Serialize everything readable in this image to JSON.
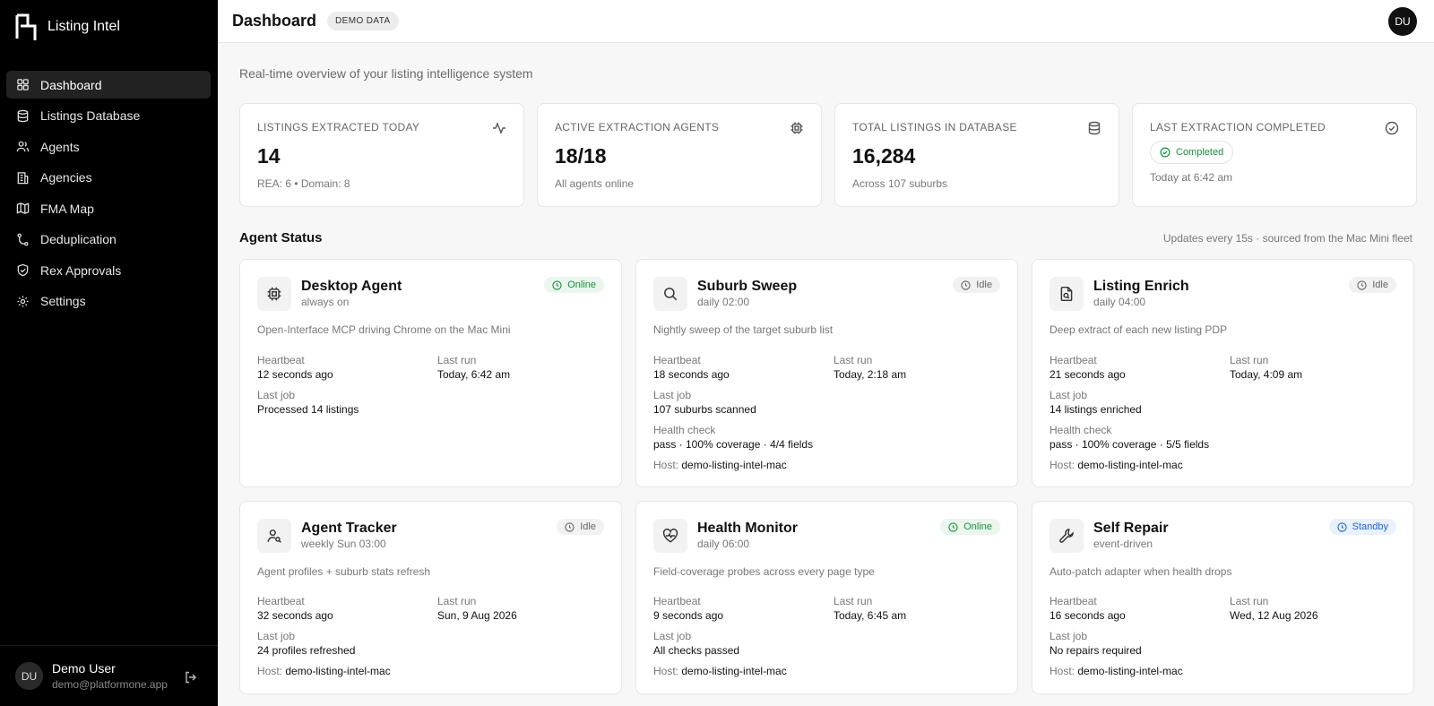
{
  "app": {
    "name": "Listing Intel"
  },
  "nav": [
    {
      "label": "Dashboard",
      "icon": "grid-icon",
      "active": true
    },
    {
      "label": "Listings Database",
      "icon": "database-icon"
    },
    {
      "label": "Agents",
      "icon": "users-icon"
    },
    {
      "label": "Agencies",
      "icon": "building-icon"
    },
    {
      "label": "FMA Map",
      "icon": "map-icon"
    },
    {
      "label": "Deduplication",
      "icon": "git-merge-icon"
    },
    {
      "label": "Rex Approvals",
      "icon": "shield-check-icon"
    },
    {
      "label": "Settings",
      "icon": "gear-icon"
    }
  ],
  "user": {
    "initials": "DU",
    "name": "Demo User",
    "email": "demo@platformone.app"
  },
  "header": {
    "title": "Dashboard",
    "badge": "DEMO DATA",
    "avatar": "DU"
  },
  "subtitle": "Real-time overview of your listing intelligence system",
  "stats": [
    {
      "label": "LISTINGS EXTRACTED TODAY",
      "value": "14",
      "sub": "REA: 6 • Domain: 8",
      "icon": "activity-icon"
    },
    {
      "label": "ACTIVE EXTRACTION AGENTS",
      "value": "18/18",
      "sub": "All agents online",
      "icon": "cpu-icon"
    },
    {
      "label": "TOTAL LISTINGS IN DATABASE",
      "value": "16,284",
      "sub": "Across 107 suburbs",
      "icon": "database-icon"
    },
    {
      "label": "LAST EXTRACTION COMPLETED",
      "pill": "Completed",
      "sub": "Today at 6:42 am",
      "icon": "check-circle-icon"
    }
  ],
  "agent_section": {
    "title": "Agent Status",
    "note": "Updates every 15s · sourced from the Mac Mini fleet"
  },
  "field_labels": {
    "heartbeat": "Heartbeat",
    "last_run": "Last run",
    "last_job": "Last job",
    "health": "Health check",
    "host": "Host:"
  },
  "agents": [
    {
      "name": "Desktop Agent",
      "schedule": "always on",
      "status": "Online",
      "icon": "cpu-icon",
      "desc": "Open-Interface MCP driving Chrome on the Mac Mini",
      "heartbeat": "12 seconds ago",
      "last_run": "Today, 6:42 am",
      "last_job": "Processed 14 listings"
    },
    {
      "name": "Suburb Sweep",
      "schedule": "daily 02:00",
      "status": "Idle",
      "icon": "search-icon",
      "desc": "Nightly sweep of the target suburb list",
      "heartbeat": "18 seconds ago",
      "last_run": "Today, 2:18 am",
      "last_job": "107 suburbs scanned",
      "health": "pass · 100% coverage · 4/4 fields",
      "host": "demo-listing-intel-mac"
    },
    {
      "name": "Listing Enrich",
      "schedule": "daily 04:00",
      "status": "Idle",
      "icon": "file-search-icon",
      "desc": "Deep extract of each new listing PDP",
      "heartbeat": "21 seconds ago",
      "last_run": "Today, 4:09 am",
      "last_job": "14 listings enriched",
      "health": "pass · 100% coverage · 5/5 fields",
      "host": "demo-listing-intel-mac"
    },
    {
      "name": "Agent Tracker",
      "schedule": "weekly Sun 03:00",
      "status": "Idle",
      "icon": "user-search-icon",
      "desc": "Agent profiles + suburb stats refresh",
      "heartbeat": "32 seconds ago",
      "last_run": "Sun, 9 Aug 2026",
      "last_job": "24 profiles refreshed",
      "host": "demo-listing-intel-mac"
    },
    {
      "name": "Health Monitor",
      "schedule": "daily 06:00",
      "status": "Online",
      "icon": "heart-pulse-icon",
      "desc": "Field-coverage probes across every page type",
      "heartbeat": "9 seconds ago",
      "last_run": "Today, 6:45 am",
      "last_job": "All checks passed",
      "host": "demo-listing-intel-mac"
    },
    {
      "name": "Self Repair",
      "schedule": "event-driven",
      "status": "Standby",
      "icon": "wrench-icon",
      "desc": "Auto-patch adapter when health drops",
      "heartbeat": "16 seconds ago",
      "last_run": "Wed, 12 Aug 2026",
      "last_job": "No repairs required",
      "host": "demo-listing-intel-mac"
    }
  ]
}
